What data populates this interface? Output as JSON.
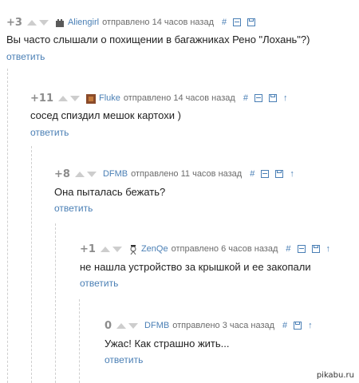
{
  "comments": [
    {
      "score": "+3",
      "author": "Aliengirl",
      "posted": "отправлено 14 часов назад",
      "text": "Вы часто слышали о похищении в багажниках Рено \"Лохань\"?)",
      "reply": "ответить",
      "has_parent_link": false
    },
    {
      "score": "+11",
      "author": "Fluke",
      "posted": "отправлено 14 часов назад",
      "text": "сосед спиздил мешок картохи )",
      "reply": "ответить",
      "has_parent_link": true
    },
    {
      "score": "+8",
      "author": "DFMB",
      "posted": "отправлено 11 часов назад",
      "text": "Она пыталась бежать?",
      "reply": "ответить",
      "has_parent_link": true
    },
    {
      "score": "+1",
      "author": "ZenQe",
      "posted": "отправлено 6 часов назад",
      "text": "не нашла устройство за крышкой и ее закопали",
      "reply": "ответить",
      "has_parent_link": true
    },
    {
      "score": "0",
      "author": "DFMB",
      "posted": "отправлено 3 часа назад",
      "text": "Ужас! Как страшно жить...",
      "reply": "ответить",
      "has_parent_link": true
    }
  ],
  "actions": {
    "permalink": "#",
    "parent": "↑"
  },
  "watermark": "pikabu.ru",
  "colors": {
    "link": "#4a7fb5",
    "score": "#8c8c8c",
    "vote_arrow": "#cdcdcd",
    "thread_line": "#cfcfcf"
  }
}
